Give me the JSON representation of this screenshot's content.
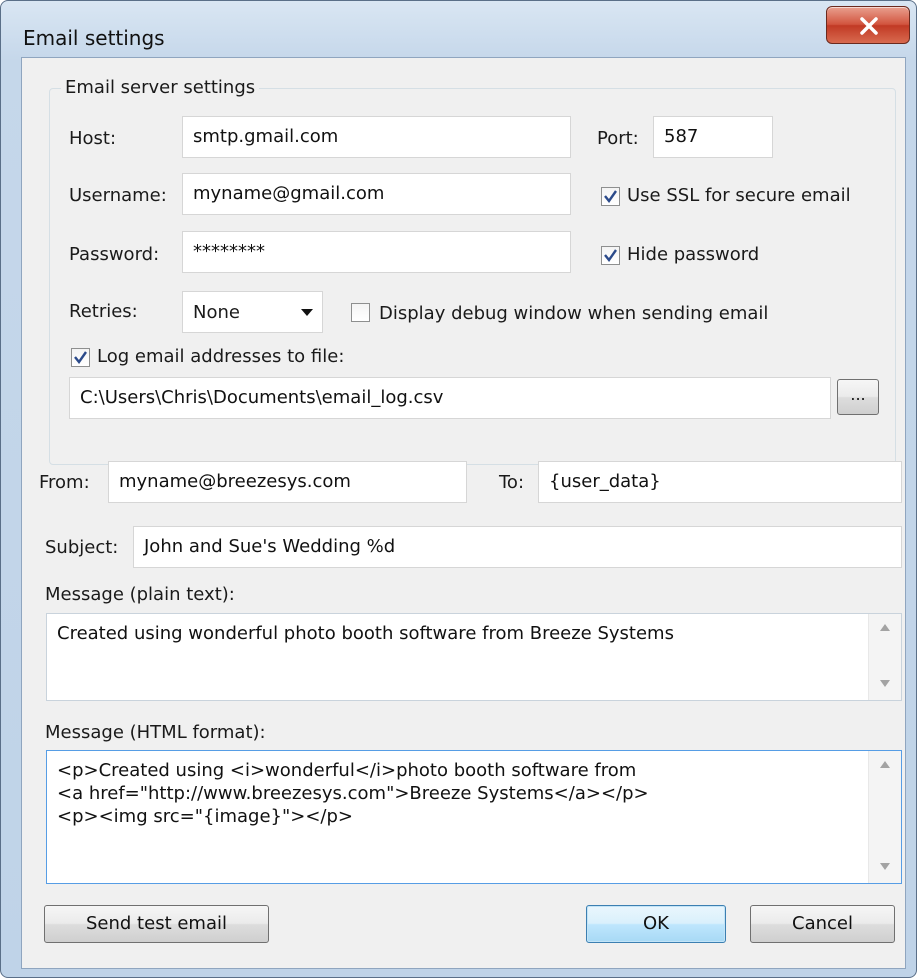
{
  "window": {
    "title": "Email settings",
    "close_label": "X"
  },
  "server": {
    "group_title": "Email server settings",
    "host_label": "Host:",
    "host_value": "smtp.gmail.com",
    "port_label": "Port:",
    "port_value": "587",
    "username_label": "Username:",
    "username_value": "myname@gmail.com",
    "ssl_label": "Use SSL for secure email",
    "ssl_checked": true,
    "password_label": "Password:",
    "password_value": "********",
    "hide_password_label": "Hide password",
    "hide_password_checked": true,
    "retries_label": "Retries:",
    "retries_value": "None",
    "debug_label": "Display debug window when sending email",
    "debug_checked": false,
    "log_label": "Log email addresses to file:",
    "log_checked": true,
    "log_path": "C:\\Users\\Chris\\Documents\\email_log.csv",
    "browse_label": "..."
  },
  "message": {
    "from_label": "From:",
    "from_value": "myname@breezesys.com",
    "to_label": "To:",
    "to_value": "{user_data}",
    "subject_label": "Subject:",
    "subject_value": "John and Sue's Wedding %d",
    "plain_label": "Message (plain text):",
    "plain_value": "Created using wonderful photo booth software from Breeze Systems",
    "html_label": "Message (HTML format):",
    "html_value": "<p>Created using <i>wonderful</i>photo booth software from\n<a href=\"http://www.breezesys.com\">Breeze Systems</a></p>\n<p><img src=\"{image}\"></p>"
  },
  "buttons": {
    "send_test": "Send test email",
    "ok": "OK",
    "cancel": "Cancel"
  }
}
